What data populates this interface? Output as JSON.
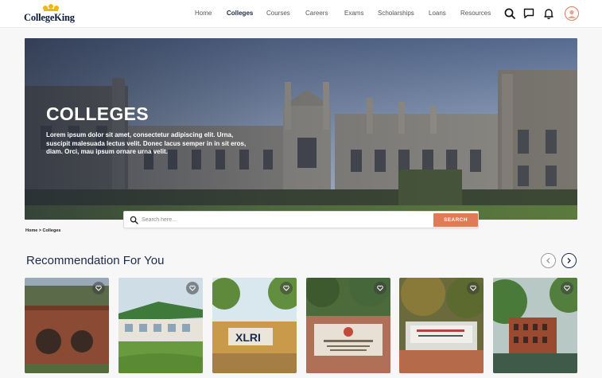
{
  "brand": {
    "name": "CollegeKing",
    "colors": {
      "accent": "#e07b5a",
      "navy": "#1d2a4a",
      "crown": "#f2b705"
    }
  },
  "nav": {
    "items": [
      {
        "label": "Home",
        "active": false
      },
      {
        "label": "Colleges",
        "active": true
      },
      {
        "label": "Courses",
        "active": false
      },
      {
        "label": "Careers",
        "active": false
      },
      {
        "label": "Exams",
        "active": false
      },
      {
        "label": "Scholarships",
        "active": false
      },
      {
        "label": "Loans",
        "active": false
      },
      {
        "label": "Resources",
        "active": false
      }
    ],
    "icons": [
      "search-icon",
      "chat-icon",
      "bell-icon",
      "user-avatar"
    ]
  },
  "hero": {
    "title": "COLLEGES",
    "text": "Lorem ipsum dolor sit amet, consectetur adipiscing elit. Urna, suscipit malesuada lectus velit. Donec lacus semper in in sit eros, diam. Orci, mau ipsum ornare urna velit."
  },
  "search": {
    "placeholder": "Search here...",
    "value": "",
    "button": "SEARCH"
  },
  "breadcrumb": "Home > Colleges",
  "recommendations": {
    "title": "Recommendation For You",
    "cards": [
      {
        "image": "brick-campus-building",
        "favorite_icon": "heart-icon"
      },
      {
        "image": "modern-campus-green-roof",
        "favorite_icon": "heart-icon"
      },
      {
        "image": "xlri-campus",
        "sign_text": "XLRI",
        "favorite_icon": "heart-icon"
      },
      {
        "image": "iim-sign-wall",
        "favorite_icon": "heart-icon"
      },
      {
        "image": "institute-name-board",
        "favorite_icon": "heart-icon"
      },
      {
        "image": "brick-building-pond",
        "favorite_icon": "heart-icon"
      }
    ]
  }
}
